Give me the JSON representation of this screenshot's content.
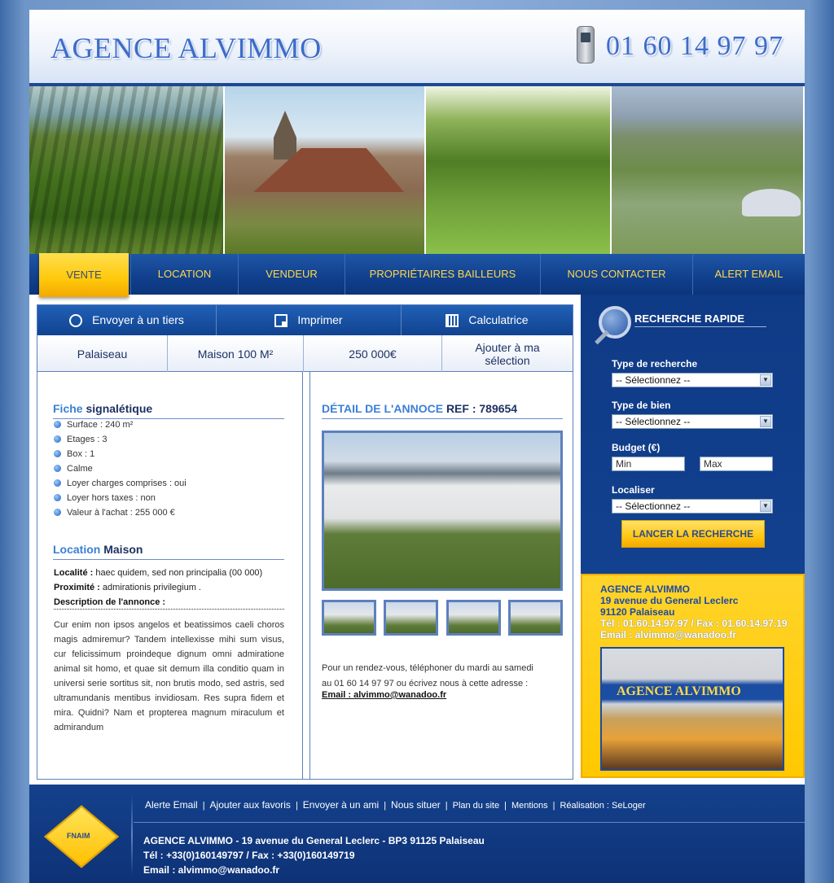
{
  "header": {
    "logo": "AGENCE ALVIMMO",
    "phone": "01 60 14 97 97"
  },
  "nav": {
    "items": [
      "VENTE",
      "LOCATION",
      "VENDEUR",
      "PROPRIÉTAIRES BAILLEURS",
      "NOUS CONTACTER",
      "ALERT EMAIL"
    ]
  },
  "actions": {
    "send": "Envoyer à un tiers",
    "print": "Imprimer",
    "calc": "Calculatrice"
  },
  "summary": {
    "city": "Palaiseau",
    "type": "Maison 100 M²",
    "price": "250 000€",
    "add": "Ajouter à ma sélection"
  },
  "fiche": {
    "title_a": "Fiche",
    "title_b": "signalétique",
    "items": [
      "Surface : 240 m²",
      "Etages : 3",
      "Box : 1",
      "Calme",
      "Loyer charges comprises : oui",
      "Loyer hors taxes : non",
      "Valeur à l'achat : 255 000 €"
    ]
  },
  "location": {
    "title_a": "Location",
    "title_b": "Maison",
    "localite_label": "Localité :",
    "localite_value": "haec quidem, sed non principalia (00 000)",
    "proximite_label": "Proximité :",
    "proximite_value": "admirationis privilegium ."
  },
  "description": {
    "title": "Description de l'annonce :",
    "text": "Cur enim non ipsos angelos et beatissimos caeli choros magis admiremur? Tandem intellexisse mihi sum visus, cur felicissimum proindeque dignum omni admiratione animal sit homo, et quae sit demum illa conditio quam in universi serie sortitus sit, non brutis modo, sed astris, sed ultramundanis mentibus invidiosam. Res supra fidem et mira. Quidni? Nam et propterea magnum miraculum et admirandum"
  },
  "detail": {
    "title_a": "DÉTAIL DE L'ANNOCE",
    "title_b": "REF : 789654",
    "rdv_line1": "Pour un rendez-vous, téléphoner du mardi au samedi",
    "rdv_line2": "au 01 60 14 97 97 ou écrivez nous à cette adresse :",
    "email": "Email : alvimmo@wanadoo.fr"
  },
  "search": {
    "title": "RECHERCHE RAPIDE",
    "type_recherche_label": "Type de recherche",
    "type_recherche_value": "-- Sélectionnez --",
    "type_bien_label": "Type de bien",
    "type_bien_value": "-- Sélectionnez --",
    "budget_label": "Budget (€)",
    "min": "Min",
    "max": "Max",
    "localiser_label": "Localiser",
    "localiser_value": "-- Sélectionnez --",
    "button": "LANCER LA RECHERCHE"
  },
  "agency": {
    "name": "AGENCE ALVIMMO",
    "street": "19 avenue du General Leclerc",
    "city": "91120 Palaiseau",
    "phones": "Tél : 01.60.14.97.97 / Fax : 01.60.14.97.19",
    "email": "Email : alvimmo@wanadoo.fr",
    "sign": "AGENCE ALVIMMO"
  },
  "footer": {
    "fnaim": "FNAIM",
    "links": [
      "Alerte Email",
      "Ajouter aux favoris",
      "Envoyer à un ami",
      "Nous situer",
      "Plan du site",
      "Mentions",
      "Réalisation : SeLoger"
    ],
    "address": "AGENCE ALVIMMO - 19 avenue du General Leclerc - BP3 91125 Palaiseau",
    "phones": "Tél : +33(0)160149797 / Fax : +33(0)160149719",
    "email": "Email : alvimmo@wanadoo.fr"
  },
  "colors": {
    "brand_blue": "#1e4891",
    "accent_yellow": "#ffc800",
    "link_blue": "#3b7fd6"
  }
}
